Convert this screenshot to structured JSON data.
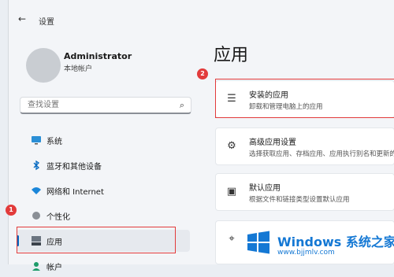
{
  "window": {
    "back_glyph": "←",
    "title": "设置"
  },
  "user": {
    "name": "Administrator",
    "account_type": "本地帐户"
  },
  "search": {
    "placeholder": "查找设置"
  },
  "sidebar": {
    "items": [
      {
        "label": "系统",
        "icon": "monitor-icon"
      },
      {
        "label": "蓝牙和其他设备",
        "icon": "bluetooth-icon"
      },
      {
        "label": "网络和 Internet",
        "icon": "wifi-icon"
      },
      {
        "label": "个性化",
        "icon": "brush-icon"
      },
      {
        "label": "应用",
        "icon": "apps-icon",
        "selected": true
      },
      {
        "label": "帐户",
        "icon": "person-icon"
      }
    ]
  },
  "page": {
    "title": "应用"
  },
  "cards": [
    {
      "title": "安装的应用",
      "subtitle": "卸载和管理电脑上的应用",
      "icon": "list-icon"
    },
    {
      "title": "高级应用设置",
      "subtitle": "选择获取应用、存档应用、应用执行别名和更新的位置",
      "icon": "advanced-apps-icon"
    },
    {
      "title": "默认应用",
      "subtitle": "根据文件和链接类型设置默认应用",
      "icon": "default-apps-icon"
    },
    {
      "title": "",
      "subtitle": "",
      "icon": "map-icon"
    }
  ],
  "annotations": {
    "step1": "1",
    "step2": "2",
    "highlight_color": "#e23b3b"
  },
  "watermark": {
    "brand": "Windows 系统之家",
    "url": "www.bjjmlv.com"
  },
  "colors": {
    "accent": "#0067c0",
    "brand_blue": "#1478d4"
  }
}
